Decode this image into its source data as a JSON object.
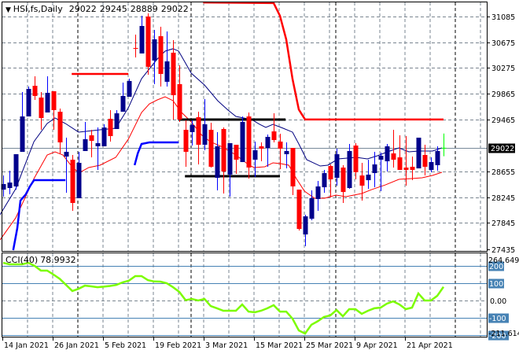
{
  "header": {
    "symbol": "HSI,fs,Daily",
    "open": "29022",
    "high": "29245",
    "low": "28889",
    "close": "29022"
  },
  "colors": {
    "bull": "#00008B",
    "bull_wick": "#0000FF",
    "bear": "#FF0000",
    "current": "#00FF00",
    "cci": "#7CFC00",
    "level": "#4682B4",
    "ma_fast": "#000080",
    "ma_slow": "#FF0000"
  },
  "chart_data": [
    {
      "type": "candlestick",
      "title": "HSI,fs,Daily",
      "ylim": [
        27435,
        31300
      ],
      "y_ticks": [
        "31085",
        "30675",
        "30275",
        "29865",
        "29465",
        "28655",
        "28245",
        "27845",
        "27435"
      ],
      "current_price": "29022",
      "x_labels": [
        "14 Jan 2021",
        "26 Jan 2021",
        "5 Feb 2021",
        "19 Feb 2021",
        "3 Mar 2021",
        "15 Mar 2021",
        "25 Mar 2021",
        "9 Apr 2021",
        "21 Apr 2021"
      ],
      "ohlc": [
        [
          28366,
          28588,
          28256,
          28453
        ],
        [
          28391,
          28662,
          28292,
          28477
        ],
        [
          28416,
          28921,
          28366,
          28921
        ],
        [
          28958,
          29895,
          28958,
          29513
        ],
        [
          29513,
          29982,
          29513,
          29945
        ],
        [
          29994,
          30142,
          29772,
          29834
        ],
        [
          29809,
          29895,
          29303,
          29488
        ],
        [
          29575,
          30142,
          29575,
          29883
        ],
        [
          29908,
          29908,
          29303,
          29612
        ],
        [
          29587,
          29636,
          28934,
          29106
        ],
        [
          28884,
          29180,
          28317,
          28958
        ],
        [
          28835,
          28909,
          28034,
          28157
        ],
        [
          28231,
          28958,
          28231,
          28786
        ],
        [
          28971,
          29427,
          28971,
          29156
        ],
        [
          29217,
          29303,
          28872,
          29131
        ],
        [
          29045,
          29340,
          28675,
          29094
        ],
        [
          29045,
          29390,
          29045,
          29340
        ],
        [
          29476,
          29612,
          29119,
          29205
        ],
        [
          29316,
          29612,
          29316,
          29562
        ],
        [
          29587,
          30043,
          29587,
          29834
        ],
        [
          29821,
          30105,
          29821,
          30068
        ],
        [
          30586,
          30795,
          30438,
          30574
        ],
        [
          30500,
          31091,
          30500,
          30931
        ],
        [
          31079,
          31128,
          30167,
          30290
        ],
        [
          30389,
          30869,
          30019,
          30722
        ],
        [
          30771,
          30919,
          29982,
          30179
        ],
        [
          30056,
          30845,
          29982,
          30376
        ],
        [
          30512,
          30709,
          29464,
          29846
        ],
        [
          30019,
          30315,
          29427,
          29464
        ],
        [
          29304,
          29452,
          28724,
          28958
        ],
        [
          29267,
          29452,
          29057,
          29378
        ],
        [
          29501,
          29587,
          28761,
          29069
        ],
        [
          29069,
          29784,
          28983,
          29390
        ],
        [
          29304,
          29415,
          28712,
          28724
        ],
        [
          28551,
          29267,
          28354,
          29045
        ],
        [
          29316,
          29340,
          28305,
          28650
        ],
        [
          28601,
          29094,
          28256,
          29094
        ],
        [
          29069,
          29069,
          28613,
          28835
        ],
        [
          28798,
          29513,
          28798,
          29427
        ],
        [
          29513,
          29575,
          28539,
          28712
        ],
        [
          28835,
          29119,
          28564,
          28983
        ],
        [
          29045,
          29106,
          28810,
          29008
        ],
        [
          29020,
          29230,
          28724,
          29193
        ],
        [
          29279,
          29562,
          29106,
          29143
        ],
        [
          29119,
          29242,
          28687,
          29008
        ],
        [
          28921,
          29106,
          28699,
          28971
        ],
        [
          29020,
          29020,
          28280,
          28416
        ],
        [
          28366,
          28366,
          27725,
          27750
        ],
        [
          27664,
          27972,
          27479,
          27947
        ],
        [
          27910,
          28354,
          27886,
          28231
        ],
        [
          28219,
          28502,
          28034,
          28416
        ],
        [
          28403,
          28675,
          28317,
          28625
        ],
        [
          28736,
          28761,
          28243,
          28527
        ],
        [
          28551,
          29008,
          28428,
          28921
        ],
        [
          28712,
          28749,
          28157,
          28329
        ],
        [
          28391,
          29082,
          28379,
          28971
        ],
        [
          29057,
          29094,
          28527,
          28638
        ],
        [
          28588,
          28786,
          28194,
          28428
        ],
        [
          28514,
          28835,
          28379,
          28601
        ],
        [
          28625,
          28958,
          28403,
          28761
        ],
        [
          28835,
          28946,
          28342,
          28897
        ],
        [
          28810,
          29082,
          28650,
          29045
        ],
        [
          28934,
          29304,
          28712,
          28835
        ],
        [
          28872,
          29217,
          28675,
          28675
        ],
        [
          28712,
          29205,
          28428,
          28675
        ],
        [
          28724,
          28884,
          28514,
          28675
        ],
        [
          28699,
          29180,
          28699,
          29180
        ],
        [
          28909,
          29069,
          28588,
          28724
        ],
        [
          28675,
          28872,
          28638,
          28798
        ],
        [
          28749,
          29045,
          28662,
          28971
        ],
        [
          29022,
          29245,
          28889,
          29022
        ]
      ],
      "ma_fast": [
        [
          -0.5,
          27972
        ],
        [
          2,
          28379
        ],
        [
          4.9,
          29119
        ],
        [
          7,
          29402
        ],
        [
          8.25,
          29489
        ],
        [
          9.9,
          29402
        ],
        [
          12,
          29267
        ],
        [
          15.4,
          29304
        ],
        [
          17.9,
          29328
        ],
        [
          19.9,
          29649
        ],
        [
          22,
          30105
        ],
        [
          24.5,
          30413
        ],
        [
          25.75,
          30537
        ],
        [
          27,
          30574
        ],
        [
          27.9,
          30537
        ],
        [
          29.9,
          30191
        ],
        [
          32,
          30006
        ],
        [
          34.1,
          29760
        ],
        [
          35.75,
          29612
        ],
        [
          37,
          29513
        ],
        [
          39.5,
          29464
        ],
        [
          40.75,
          29390
        ],
        [
          41.75,
          29341
        ],
        [
          42.9,
          29390
        ],
        [
          44.5,
          29328
        ],
        [
          46,
          29267
        ],
        [
          47,
          29082
        ],
        [
          48.25,
          28835
        ],
        [
          50.4,
          28736
        ],
        [
          51.6,
          28749
        ],
        [
          53.25,
          28847
        ],
        [
          56.1,
          28872
        ],
        [
          57.9,
          28847
        ],
        [
          59.5,
          28897
        ],
        [
          61.1,
          28958
        ],
        [
          62.9,
          29020
        ],
        [
          64.5,
          28958
        ],
        [
          66.1,
          28971
        ],
        [
          68.25,
          28971
        ],
        [
          69.75,
          29020
        ]
      ],
      "ma_slow": [
        [
          -0.5,
          27577
        ],
        [
          2,
          27923
        ],
        [
          4.9,
          28539
        ],
        [
          7,
          28909
        ],
        [
          8.25,
          28958
        ],
        [
          9.5,
          28909
        ],
        [
          10.75,
          28749
        ],
        [
          12,
          28625
        ],
        [
          13.6,
          28712
        ],
        [
          15.4,
          28749
        ],
        [
          17.9,
          28872
        ],
        [
          19.9,
          29156
        ],
        [
          22,
          29575
        ],
        [
          23.25,
          29710
        ],
        [
          24.5,
          29772
        ],
        [
          25.75,
          29821
        ],
        [
          27,
          29760
        ],
        [
          28.25,
          29587
        ],
        [
          29.9,
          29427
        ],
        [
          31.6,
          29217
        ],
        [
          32.9,
          29119
        ],
        [
          34.9,
          29032
        ],
        [
          37,
          28909
        ],
        [
          39.1,
          28749
        ],
        [
          39.9,
          28712
        ],
        [
          41.6,
          28724
        ],
        [
          42.9,
          28786
        ],
        [
          44.1,
          28773
        ],
        [
          45.4,
          28749
        ],
        [
          46.6,
          28539
        ],
        [
          47.9,
          28342
        ],
        [
          49.5,
          28231
        ],
        [
          51.1,
          28231
        ],
        [
          52.9,
          28280
        ],
        [
          54.5,
          28256
        ],
        [
          57,
          28305
        ],
        [
          58.6,
          28367
        ],
        [
          60.75,
          28440
        ],
        [
          62.9,
          28527
        ],
        [
          64.9,
          28539
        ],
        [
          66.6,
          28551
        ],
        [
          68.25,
          28588
        ],
        [
          69.75,
          28638
        ]
      ],
      "upper_step": [
        [
          [
            10.9,
            30179
          ],
          [
            19.9,
            30179
          ]
        ],
        [
          [
            31.8,
            31300
          ],
          [
            43,
            31290
          ],
          [
            44,
            31090
          ],
          [
            45,
            30720
          ],
          [
            46,
            30100
          ],
          [
            47,
            29620
          ],
          [
            48,
            29465
          ],
          [
            70,
            29465
          ]
        ]
      ],
      "lower_step": [
        [
          [
            1.6,
            27417
          ],
          [
            2.25,
            27762
          ],
          [
            2.75,
            28194
          ],
          [
            3.6,
            28292
          ],
          [
            4.25,
            28416
          ],
          [
            4.9,
            28514
          ],
          [
            9.9,
            28514
          ]
        ],
        [
          [
            20.9,
            28749
          ],
          [
            21.4,
            28934
          ],
          [
            22,
            29082
          ],
          [
            23.25,
            29106
          ],
          [
            27.9,
            29106
          ]
        ]
      ],
      "resistance": {
        "price": 29464,
        "from": 27.9,
        "to": 44.9
      },
      "support": {
        "price": 28576,
        "from": 28.9,
        "to": 44
      }
    },
    {
      "type": "line",
      "title": "CCI(40)",
      "value_label": "78.9932",
      "max_label": "264.6492",
      "min_label": "-211.6143",
      "levels": [
        "200",
        "100",
        "-100",
        "-200"
      ],
      "zero_label": "0.00",
      "ylim": [
        -211.6143,
        264.6492
      ],
      "values": [
        218,
        209,
        209,
        209,
        218,
        200,
        173,
        173,
        150,
        125,
        90,
        55,
        68,
        86,
        82,
        77,
        80,
        84,
        90,
        105,
        115,
        141,
        141,
        118,
        110,
        109,
        100,
        77,
        50,
        2,
        9,
        0,
        9,
        -32,
        -45,
        -59,
        -59,
        -59,
        -23,
        -64,
        -68,
        -59,
        -45,
        -27,
        -64,
        -64,
        -105,
        -173,
        -191,
        -140,
        -120,
        -95,
        -86,
        -55,
        -91,
        -50,
        -50,
        -77,
        -59,
        -45,
        -41,
        -18,
        -5,
        -23,
        -50,
        -41,
        41,
        0,
        0,
        27,
        79
      ]
    }
  ]
}
